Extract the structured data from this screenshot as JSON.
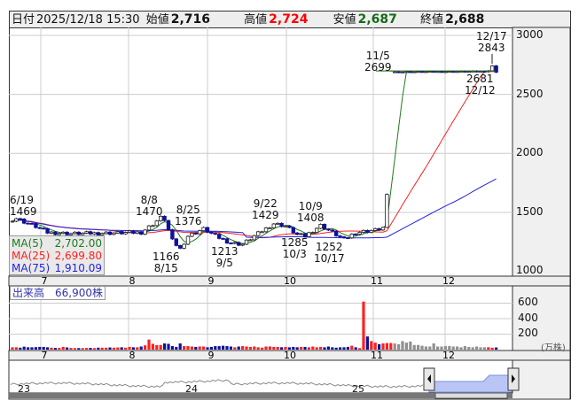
{
  "header": {
    "date_label": "日付",
    "date": "2025/12/18 15:30",
    "open_label": "始値",
    "open": "2,716",
    "high_label": "高値",
    "high": "2,724",
    "low_label": "安値",
    "low": "2,687",
    "close_label": "終値",
    "close": "2,688"
  },
  "colors": {
    "up_volume": "#ff2020",
    "down_volume": "#10109a",
    "flat_volume": "#909090",
    "ma5": "#1e7a1e",
    "ma25": "#ff2020",
    "ma75": "#2424e0",
    "down_candle": "#10109a"
  },
  "ma_legend": [
    {
      "label": "MA(5)",
      "value": "2,702.00"
    },
    {
      "label": "MA(25)",
      "value": "2,699.80"
    },
    {
      "label": "MA(75)",
      "value": "1,910.09"
    }
  ],
  "annotations": {
    "a1": [
      "6/19",
      "1469"
    ],
    "a2": [
      "8/8",
      "1470"
    ],
    "a3": [
      "8/25",
      "1376"
    ],
    "a4": [
      "1166",
      "8/15"
    ],
    "a5": [
      "9/22",
      "1429"
    ],
    "a6": [
      "1213",
      "9/5"
    ],
    "a7": [
      "10/9",
      "1408"
    ],
    "a8": [
      "1285",
      "10/3"
    ],
    "a9": [
      "1252",
      "10/17"
    ],
    "a10": [
      "11/5",
      "2699"
    ],
    "a11": [
      "12/17",
      "2843"
    ],
    "a12": [
      "2681",
      "12/12"
    ]
  },
  "price_axis": [
    "3000",
    "2500",
    "2000",
    "1500",
    "1000"
  ],
  "months": [
    "7",
    "8",
    "9",
    "10",
    "11",
    "12"
  ],
  "volume": {
    "label": "出来高　66,900株",
    "axis": [
      "600",
      "400",
      "200"
    ],
    "unit": "(万株)"
  },
  "navigator": {
    "years": [
      "23",
      "24",
      "25"
    ]
  },
  "chart_data": {
    "type": "candlestick",
    "price_range": [
      1000,
      3000
    ],
    "anchors": [
      [
        0,
        1440
      ],
      [
        1,
        1450
      ],
      [
        3,
        1420
      ],
      [
        6,
        1380
      ],
      [
        9,
        1330
      ],
      [
        15,
        1320
      ],
      [
        25,
        1325
      ],
      [
        33,
        1330
      ],
      [
        36,
        1400
      ],
      [
        38,
        1455
      ],
      [
        39,
        1440
      ],
      [
        41,
        1260
      ],
      [
        43,
        1190
      ],
      [
        45,
        1300
      ],
      [
        49,
        1360
      ],
      [
        52,
        1300
      ],
      [
        56,
        1240
      ],
      [
        59,
        1230
      ],
      [
        62,
        1300
      ],
      [
        67,
        1405
      ],
      [
        70,
        1385
      ],
      [
        73,
        1310
      ],
      [
        75,
        1300
      ],
      [
        79,
        1390
      ],
      [
        82,
        1330
      ],
      [
        85,
        1270
      ],
      [
        88,
        1330
      ],
      [
        93,
        1350
      ],
      [
        95,
        1370
      ],
      [
        96,
        1650
      ],
      [
        97,
        2690
      ],
      [
        121,
        2695
      ],
      [
        122,
        2700
      ],
      [
        123,
        2740
      ],
      [
        124,
        2688
      ]
    ],
    "volumes": [
      30,
      30,
      25,
      38,
      30,
      30,
      32,
      35,
      35,
      30,
      25,
      22,
      22,
      35,
      28,
      22,
      20,
      20,
      20,
      22,
      22,
      20,
      25,
      25,
      25,
      28,
      25,
      28,
      30,
      25,
      35,
      30,
      30,
      40,
      55,
      130,
      75,
      58,
      60,
      80,
      75,
      45,
      35,
      80,
      45,
      45,
      40,
      35,
      40,
      40,
      30,
      35,
      45,
      45,
      50,
      45,
      40,
      30,
      40,
      45,
      40,
      35,
      40,
      30,
      25,
      40,
      40,
      35,
      35,
      30,
      35,
      30,
      35,
      30,
      35,
      35,
      30,
      40,
      30,
      35,
      30,
      40,
      30,
      25,
      30,
      30,
      35,
      50,
      30,
      20,
      620,
      170,
      110,
      90,
      70,
      80,
      85,
      85,
      80,
      70,
      110,
      90,
      105,
      60,
      60,
      50,
      40,
      40,
      80,
      40,
      40,
      45,
      45,
      40,
      40,
      30,
      45,
      35,
      30,
      40,
      30,
      30,
      30,
      25,
      28
    ],
    "ma_windows": [
      5,
      25,
      75
    ]
  }
}
